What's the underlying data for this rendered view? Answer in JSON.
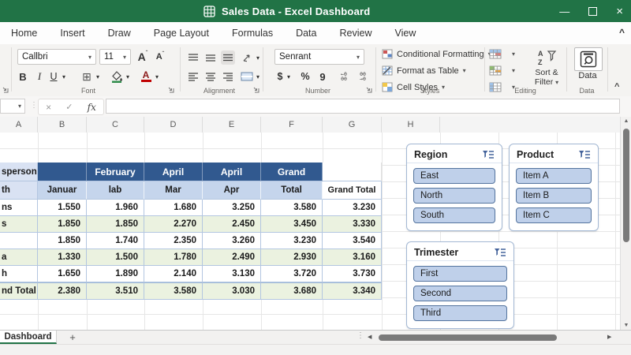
{
  "window": {
    "title": "Sales Data - Excel Dashboard"
  },
  "ribbon": {
    "tabs": [
      "Home",
      "Insert",
      "Draw",
      "Page Layout",
      "Formulas",
      "Data",
      "Review",
      "View"
    ],
    "font": {
      "label": "Font",
      "name": "Callbri",
      "size": "11",
      "bold": "B",
      "italic": "I",
      "underline": "U"
    },
    "alignment": {
      "label": "Alignment"
    },
    "number": {
      "label": "Number",
      "format": "Senrant",
      "currency": "$",
      "percent": "%",
      "comma": "9"
    },
    "styles": {
      "label": "Styles",
      "items": [
        "Conditional Formatting",
        "Format as Table",
        "Cell Styles"
      ]
    },
    "editing": {
      "label": "Editing",
      "sort_filter_line1": "Sort &",
      "sort_filter_line2": "Filter"
    },
    "data_group": {
      "label": "Data",
      "button": "Data"
    }
  },
  "formula_bar": {
    "name_box": "",
    "fx": "fx",
    "value": ""
  },
  "grid": {
    "columns": [
      "A",
      "B",
      "C",
      "D",
      "E",
      "F",
      "G",
      "H"
    ]
  },
  "table": {
    "corner_top": "sperson",
    "corner_bottom": "th",
    "header_top": [
      "",
      "February",
      "April",
      "April",
      "Grand"
    ],
    "header_bottom": [
      "Januar",
      "lab",
      "Mar",
      "Apr",
      "Total"
    ],
    "grand_total_header": "Grand Total",
    "rows": [
      {
        "label": "ns",
        "values": [
          "1.550",
          "1.960",
          "1.680",
          "3.250",
          "3.580",
          "3.230"
        ]
      },
      {
        "label": "s",
        "values": [
          "1.850",
          "1.850",
          "2.270",
          "2.450",
          "3.450",
          "3.330"
        ]
      },
      {
        "label": "",
        "values": [
          "1.850",
          "1.740",
          "2.350",
          "3.260",
          "3.230",
          "3.540"
        ]
      },
      {
        "label": "a",
        "values": [
          "1.330",
          "1.500",
          "1.780",
          "2.490",
          "2.930",
          "3.160"
        ]
      },
      {
        "label": "h",
        "values": [
          "1.650",
          "1.890",
          "2.140",
          "3.130",
          "3.720",
          "3.730"
        ]
      },
      {
        "label": "nd Total",
        "values": [
          "2.380",
          "3.510",
          "3.580",
          "3.030",
          "3.680",
          "3.340"
        ]
      }
    ]
  },
  "slicers": [
    {
      "title": "Region",
      "items": [
        "East",
        "North",
        "South"
      ]
    },
    {
      "title": "Product",
      "items": [
        "Item A",
        "Item B",
        "Item C"
      ]
    },
    {
      "title": "Trimester",
      "items": [
        "First",
        "Second",
        "Third"
      ]
    }
  ],
  "sheet_tabs": {
    "active": "Dashboard",
    "add_label": "+"
  },
  "colors": {
    "titlebar_green": "#217346",
    "header_dark_blue": "#31598f",
    "header_light_blue": "#c5d5ec",
    "corner_blue": "#d9e2f3",
    "row_green": "#ebf2e0",
    "slicer_item_blue": "#bfd0ea"
  }
}
